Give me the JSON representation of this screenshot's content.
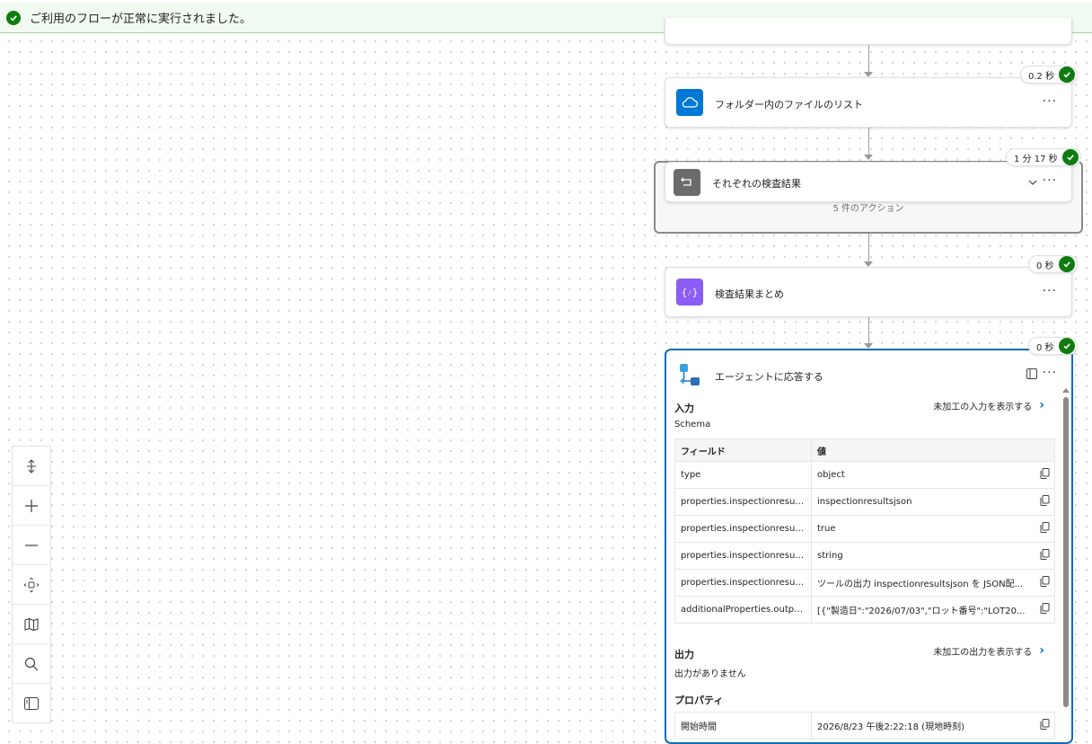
{
  "banner": {
    "message": "ご利用のフローが正常に実行されました。"
  },
  "steps": [
    {
      "title": "フォルダー内のファイルのリスト",
      "duration": "0.2 秒",
      "icon": "onedrive-icon"
    },
    {
      "title": "それぞれの検査結果",
      "duration": "1 分 17 秒",
      "icon": "loop-icon",
      "summary": "5 件のアクション"
    },
    {
      "title": "検査結果まとめ",
      "duration": "0 秒",
      "icon": "compose-icon"
    },
    {
      "title": "エージェントに応答する",
      "duration": "0 秒",
      "icon": "agent-icon"
    }
  ],
  "panel": {
    "input_heading": "入力",
    "raw_input_link": "未加工の入力を表示する",
    "schema_label": "Schema",
    "table_headers": [
      "フィールド",
      "値"
    ],
    "rows": [
      [
        "type",
        "object"
      ],
      [
        "properties.inspectionresultsj...",
        "inspectionresultsjson"
      ],
      [
        "properties.inspectionresultsj...",
        "true"
      ],
      [
        "properties.inspectionresultsj...",
        "string"
      ],
      [
        "properties.inspectionresultsj...",
        "ツールの出力 inspectionresultsjson を JSON配..."
      ],
      [
        "additionalProperties.output...",
        "[{\"製造日\":\"2026/07/03\",\"ロット番号\":\"LOT20..."
      ]
    ],
    "output_heading": "出力",
    "raw_output_link": "未加工の出力を表示する",
    "no_output": "出力がありません",
    "properties_heading": "プロパティ",
    "property_rows": [
      [
        "開始時間",
        "2026/8/23 午後2:22:18 (現地時刻)"
      ]
    ]
  },
  "colors": {
    "success": "#107c10",
    "accent": "#0f6cbd",
    "onedrive": "#0078d4",
    "loop": "#6b6b6b",
    "compose": "#8b5cf6"
  }
}
